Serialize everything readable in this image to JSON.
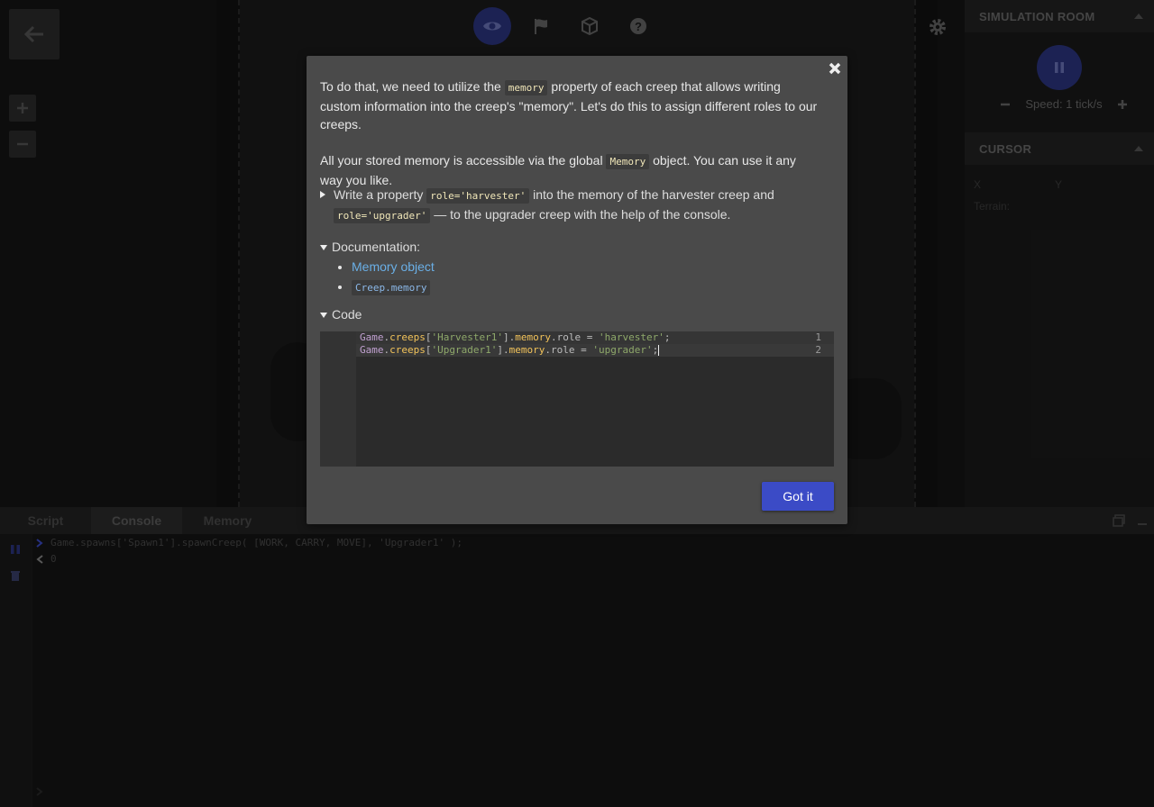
{
  "right_panel": {
    "room_title": "SIMULATION ROOM",
    "speed_label": "Speed: 1 tick/s",
    "cursor_title": "CURSOR",
    "cursor_x": "X",
    "cursor_y": "Y",
    "terrain": "Terrain:"
  },
  "bottom": {
    "tabs": [
      "Script",
      "Console",
      "Memory"
    ],
    "active_tab": "Console",
    "console_command": "Game.spawns['Spawn1'].spawnCreep( [WORK, CARRY, MOVE], 'Upgrader1' );",
    "console_result": "0"
  },
  "modal": {
    "p1_before": "To do that, we need to utilize the ",
    "p1_code": "memory",
    "p1_after": " property of each creep that allows writing custom information into the creep's \"memory\". Let's do this to assign different roles to our creeps.",
    "p2_before": "All your stored memory is accessible via the global ",
    "p2_code": "Memory",
    "p2_after": " object. You can use it any way you like.",
    "task_before": "Write a property ",
    "task_code1": "role='harvester'",
    "task_middle": " into the memory of the harvester creep and ",
    "task_code2": "role='upgrader'",
    "task_after": " — to the upgrader creep with the help of the console.",
    "docs_title": "Documentation:",
    "doc_link1": "Memory object",
    "doc_link2": "Creep.memory",
    "code_title": "Code",
    "code_lines": [
      {
        "num": "1",
        "obj": "Game",
        "d1": ".",
        "p1": "creeps",
        "b1": "[",
        "s1": "'Harvester1'",
        "b2": "].",
        "p2": "memory",
        "rest": ".role = ",
        "s2": "'harvester'",
        "end": ";"
      },
      {
        "num": "2",
        "obj": "Game",
        "d1": ".",
        "p1": "creeps",
        "b1": "[",
        "s1": "'Upgrader1'",
        "b2": "].",
        "p2": "memory",
        "rest": ".role = ",
        "s2": "'upgrader'",
        "end": ";"
      }
    ],
    "button_label": "Got it"
  },
  "colors": {
    "accent": "#3b4bc6",
    "active_tool": "#2c3580",
    "link": "#6aafe6"
  },
  "icons": [
    "back-arrow-icon",
    "zoom-in-icon",
    "zoom-out-icon",
    "eye-icon",
    "flag-icon",
    "cube-icon",
    "help-icon",
    "gear-icon",
    "pause-icon",
    "close-icon"
  ]
}
